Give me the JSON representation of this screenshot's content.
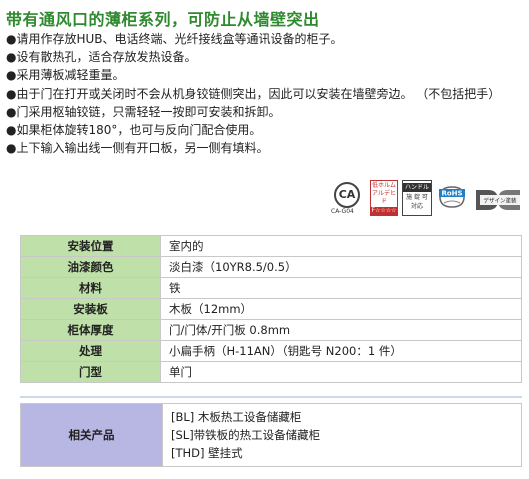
{
  "title": "带有通风口的薄柜系列，可防止从墙壁突出",
  "features": [
    "●请用作存放HUB、电话终端、光纤接线盒等通讯设备的柜子。",
    "●设有散热孔，适合存放发热设备。",
    "●采用薄板减轻重量。",
    "●由于门在打开或关闭时不会从机身铰链侧突出，因此可以安装在墙壁旁边。 （不包括把手）",
    "●门采用枢轴铰链，只需轻轻一按即可安装和拆卸。",
    "●如果柜体旋转180°，也可与反向门配合使用。",
    "●上下输入输出线一侧有开口板，另一侧有填料。"
  ],
  "logos": {
    "ca": "CA",
    "ca_sub": "CA-G04",
    "fstar_line1": "低ホルム",
    "fstar_line2": "アルデヒド",
    "fstar_mark": "F☆☆☆☆",
    "handle_line1": "ハンドル",
    "handle_line2": "施 錠 可",
    "handle_line3": "対応",
    "rohs": "RoHS",
    "design": "デザイン塗装"
  },
  "spec": [
    {
      "label": "安装位置",
      "value": "室内的"
    },
    {
      "label": "油漆颜色",
      "value": "淡白漆（10YR8.5/0.5）"
    },
    {
      "label": "材料",
      "value": "铁"
    },
    {
      "label": "安装板",
      "value": "木板（12mm）"
    },
    {
      "label": "柜体厚度",
      "value": "门/门体/开门板 0.8mm"
    },
    {
      "label": "处理",
      "value": "小扁手柄（H-11AN）（钥匙号 N200：1 件）"
    },
    {
      "label": "门型",
      "value": "单门"
    }
  ],
  "related": {
    "label": "相关产品",
    "items": [
      "[BL] 木板热工设备储藏柜",
      "[SL]带铁板的热工设备储藏柜",
      "[THD] 壁挂式"
    ]
  },
  "colors": {
    "title": "#2f8a2f",
    "spec_label_bg": "#bfe0a8",
    "related_label_bg": "#b8b6e2"
  }
}
